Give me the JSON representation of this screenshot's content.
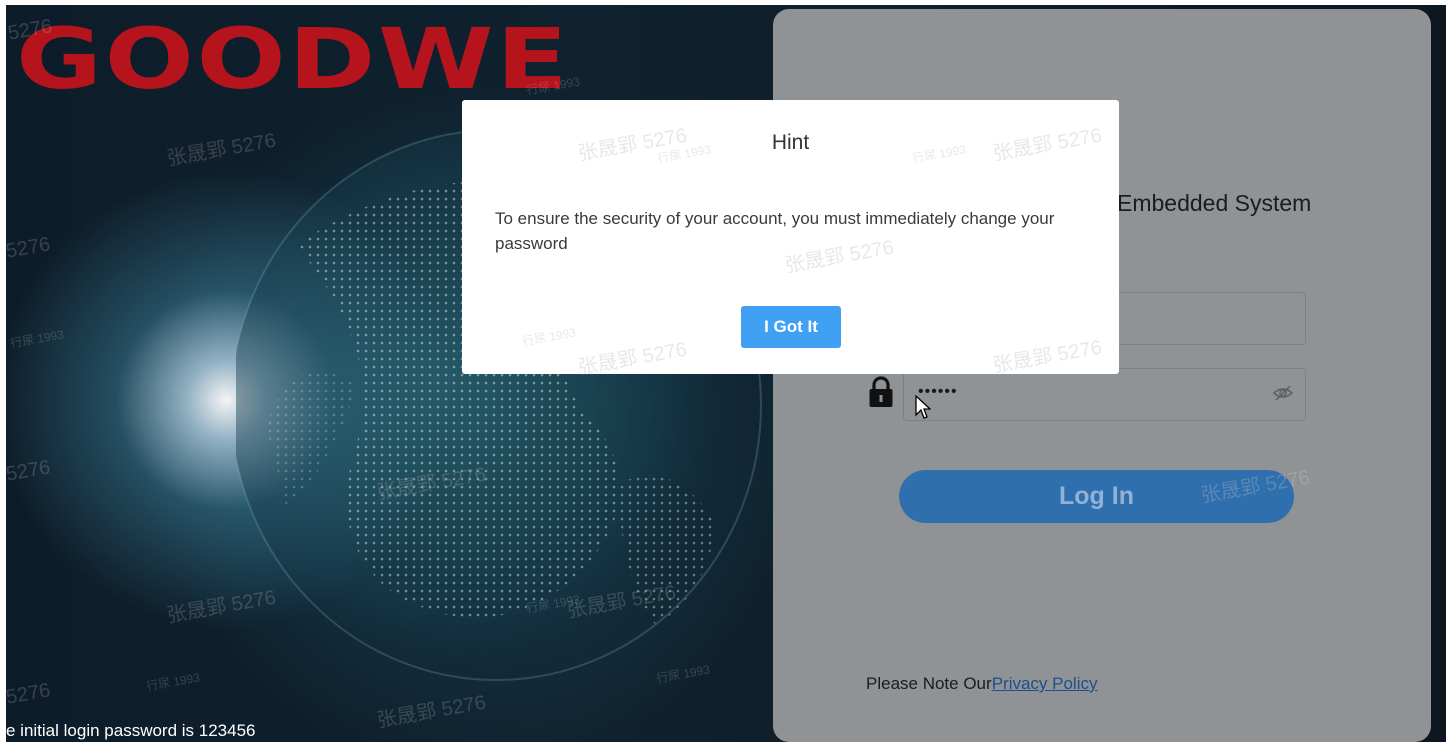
{
  "background": {
    "logo_text": "GOODWE",
    "bottom_note": "e initial login password is 123456",
    "watermark_name": "张晟郢 5276",
    "watermark_id": "行尿 1993",
    "watermark_fragment": "5276"
  },
  "login_panel": {
    "title_visible": "Embedded System",
    "password_mask": "••••••",
    "login_label": "Log In",
    "privacy_prefix": "Please Note Our",
    "privacy_link": "Privacy Policy"
  },
  "modal": {
    "title": "Hint",
    "message": "To ensure the security of your account, you must immediately change your password",
    "button_label": "I Got It"
  },
  "icons": {
    "lock": "lock-icon",
    "eye": "eye-slash-icon",
    "cursor": "mouse-pointer-icon"
  },
  "colors": {
    "brand_red": "#b6141c",
    "modal_button": "#3fa0f4",
    "login_button": "#2f6fae"
  }
}
